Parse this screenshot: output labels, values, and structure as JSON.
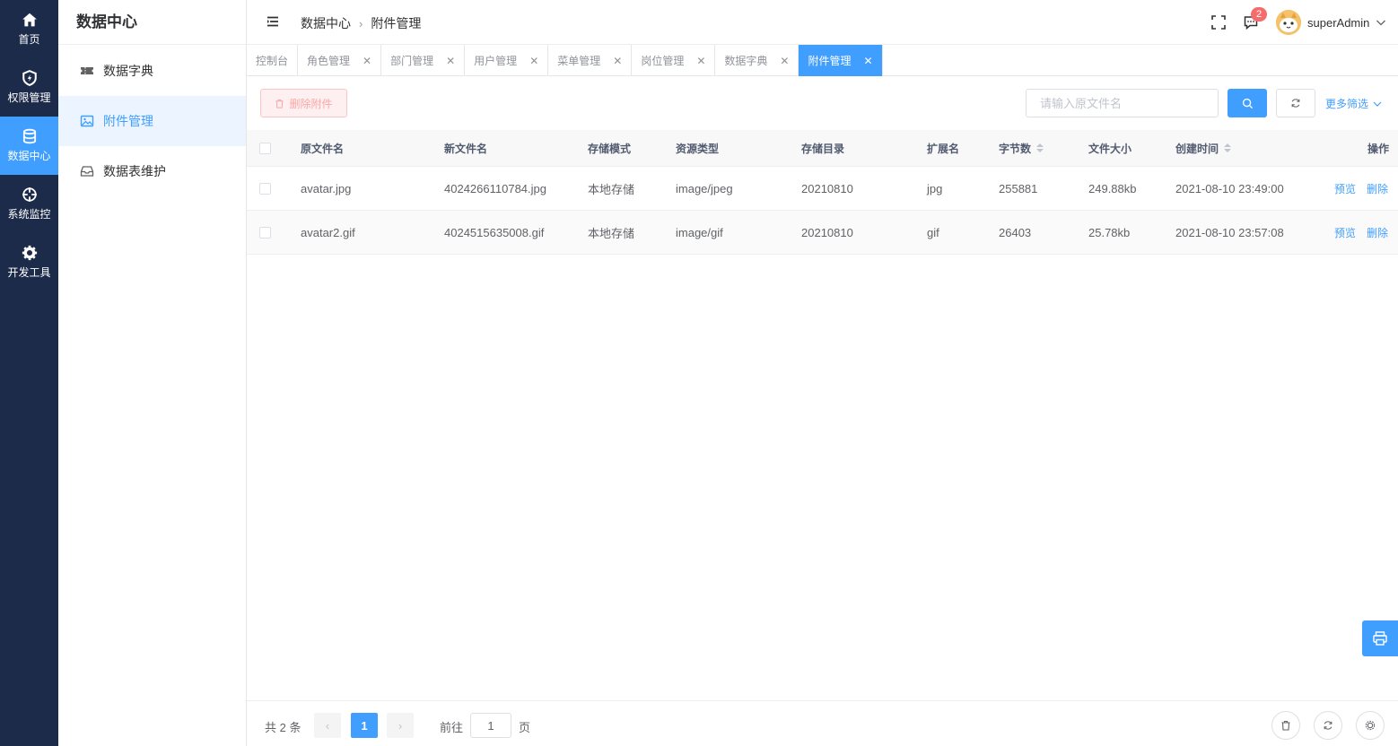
{
  "rail": {
    "items": [
      {
        "label": "首页",
        "icon": "home-icon"
      },
      {
        "label": "权限管理",
        "icon": "shield-icon"
      },
      {
        "label": "数据中心",
        "icon": "database-icon"
      },
      {
        "label": "系统监控",
        "icon": "crosshair-icon"
      },
      {
        "label": "开发工具",
        "icon": "gear-icon"
      }
    ]
  },
  "subnav": {
    "title": "数据中心",
    "items": [
      {
        "label": "数据字典",
        "icon": "ticket-icon"
      },
      {
        "label": "附件管理",
        "icon": "image-icon"
      },
      {
        "label": "数据表维护",
        "icon": "inbox-icon"
      }
    ]
  },
  "header": {
    "breadcrumb": [
      "数据中心",
      "附件管理"
    ],
    "notification_count": "2",
    "username": "superAdmin"
  },
  "tabs": [
    {
      "label": "控制台",
      "closable": false
    },
    {
      "label": "角色管理",
      "closable": true
    },
    {
      "label": "部门管理",
      "closable": true
    },
    {
      "label": "用户管理",
      "closable": true
    },
    {
      "label": "菜单管理",
      "closable": true
    },
    {
      "label": "岗位管理",
      "closable": true
    },
    {
      "label": "数据字典",
      "closable": true
    },
    {
      "label": "附件管理",
      "closable": true,
      "active": true
    }
  ],
  "toolbar": {
    "delete_label": "删除附件",
    "search_placeholder": "请输入原文件名",
    "search_value": "",
    "more_filter_label": "更多筛选"
  },
  "table": {
    "columns": [
      "原文件名",
      "新文件名",
      "存储模式",
      "资源类型",
      "存储目录",
      "扩展名",
      "字节数",
      "文件大小",
      "创建时间",
      "操作"
    ],
    "rows": [
      {
        "original": "avatar.jpg",
        "new_name": "4024266110784.jpg",
        "storage": "本地存储",
        "mime": "image/jpeg",
        "dir": "20210810",
        "ext": "jpg",
        "bytes": "255881",
        "size": "249.88kb",
        "created": "2021-08-10 23:49:00"
      },
      {
        "original": "avatar2.gif",
        "new_name": "4024515635008.gif",
        "storage": "本地存储",
        "mime": "image/gif",
        "dir": "20210810",
        "ext": "gif",
        "bytes": "26403",
        "size": "25.78kb",
        "created": "2021-08-10 23:57:08"
      }
    ],
    "preview_label": "预览",
    "delete_label": "删除"
  },
  "pagination": {
    "total_text": "共 2 条",
    "current_page": "1",
    "goto_label": "前往",
    "goto_value": "1",
    "page_suffix": "页"
  },
  "colors": {
    "primary": "#409eff",
    "rail_bg": "#1d2b4a",
    "danger": "#f56c6c"
  }
}
